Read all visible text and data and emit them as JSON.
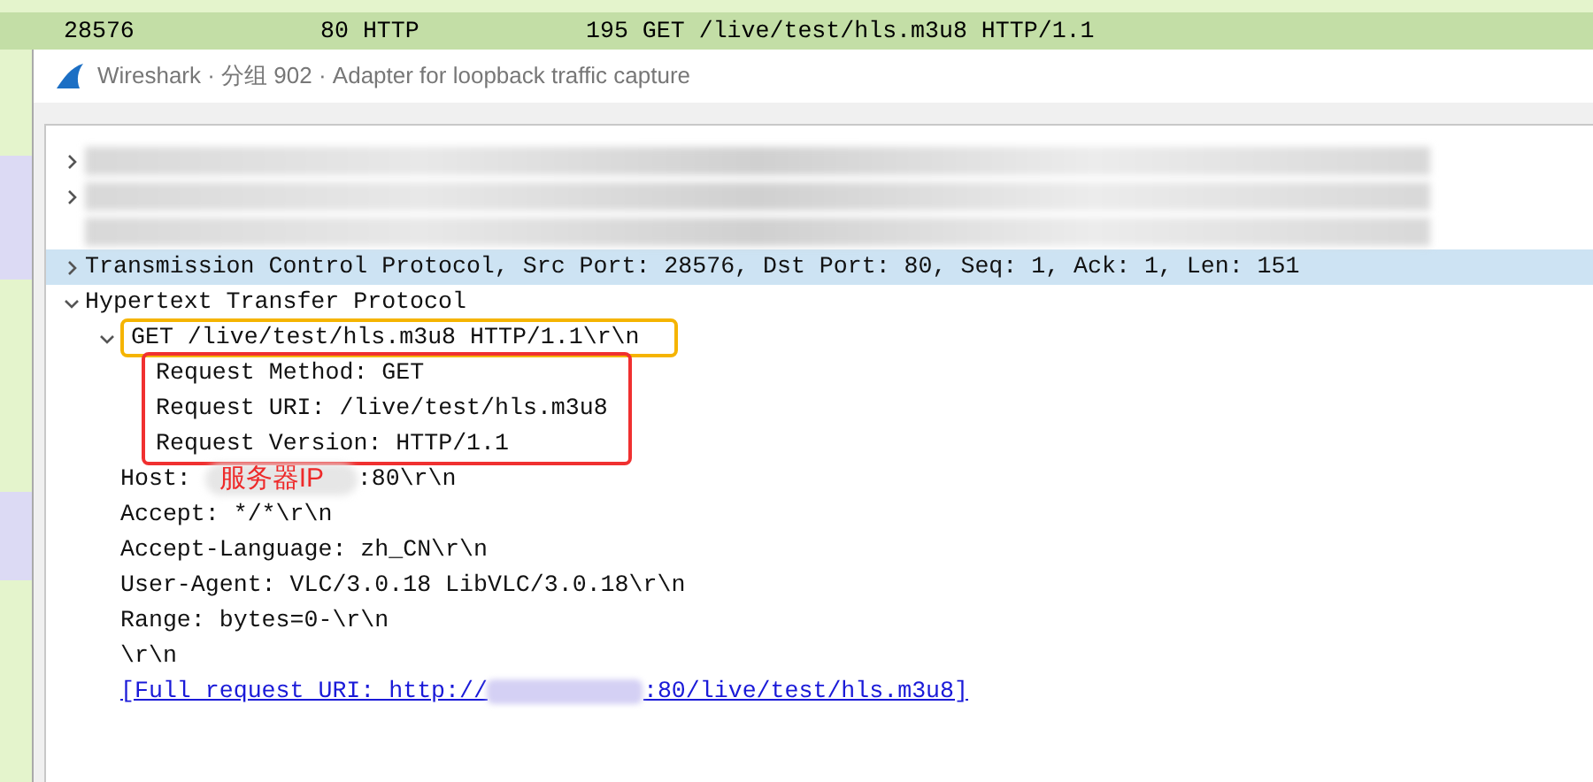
{
  "packet_list": {
    "row": {
      "selected": true,
      "columns": [
        "28576",
        "80 HTTP",
        "195 GET /live/test/hls.m3u8 HTTP/1.1"
      ]
    }
  },
  "dialog": {
    "title": "Wireshark · 分组 902 · Adapter for loopback traffic capture"
  },
  "tree": [
    {
      "kind": "redacted",
      "expanded": false,
      "selected": false
    },
    {
      "kind": "redacted",
      "expanded": false,
      "selected": false
    },
    {
      "kind": "redacted",
      "selected": false
    },
    {
      "kind": "text",
      "text": "Transmission Control Protocol, Src Port: 28576, Dst Port: 80, Seq: 1, Ack: 1, Len: 151",
      "expanded": false,
      "selected": true
    },
    {
      "kind": "text",
      "text": "Hypertext Transfer Protocol",
      "expanded": true,
      "selected": false,
      "children": [
        {
          "kind": "text",
          "text": "GET /live/test/hls.m3u8 HTTP/1.1\\r\\n",
          "expanded": true,
          "selected": false,
          "boxed": true,
          "children_boxed": true,
          "children": [
            {
              "kind": "text",
              "text": "Request Method: GET",
              "selected": false
            },
            {
              "kind": "text",
              "text": "Request URI: /live/test/hls.m3u8",
              "selected": false
            },
            {
              "kind": "text",
              "text": "Request Version: HTTP/1.1",
              "selected": false
            }
          ]
        },
        {
          "kind": "host",
          "prefix": "Host: ",
          "suffix": ":80\\r\\n",
          "annotation": "服务器IP",
          "selected": false
        },
        {
          "kind": "text",
          "text": "Accept: */*\\r\\n",
          "selected": false
        },
        {
          "kind": "text",
          "text": "Accept-Language: zh_CN\\r\\n",
          "selected": false
        },
        {
          "kind": "text",
          "text": "User-Agent: VLC/3.0.18 LibVLC/3.0.18\\r\\n",
          "selected": false
        },
        {
          "kind": "text",
          "text": "Range: bytes=0-\\r\\n",
          "selected": false
        },
        {
          "kind": "text",
          "text": "\\r\\n",
          "selected": false
        },
        {
          "kind": "link",
          "prefix": "[Full request URI: http://",
          "suffix": ":80/live/test/hls.m3u8]",
          "selected": false
        }
      ]
    }
  ]
}
